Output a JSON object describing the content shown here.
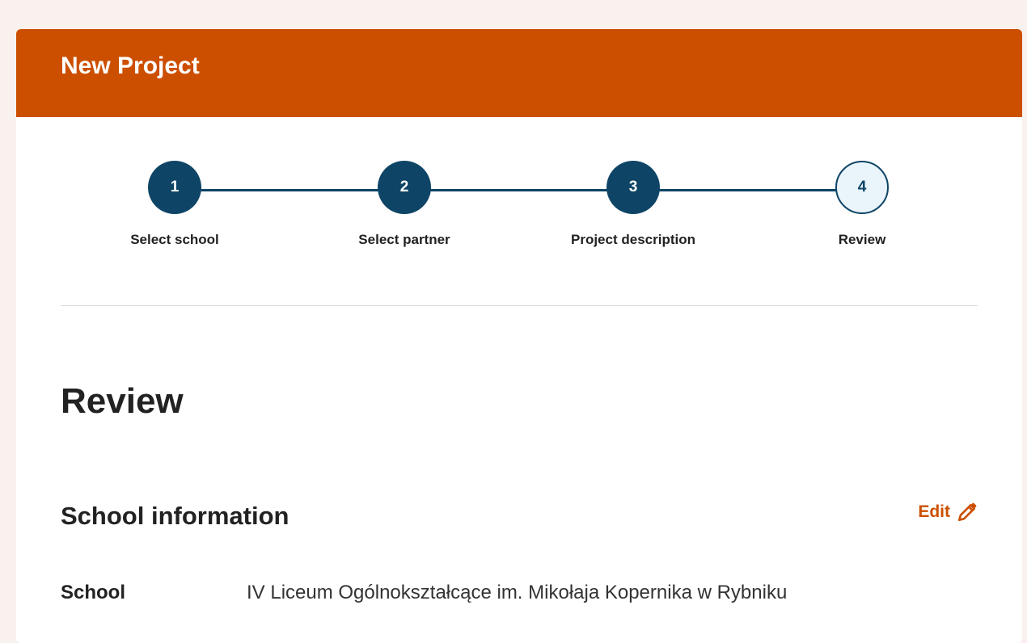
{
  "header": {
    "title": "New Project"
  },
  "stepper": {
    "steps": [
      {
        "number": "1",
        "label": "Select school"
      },
      {
        "number": "2",
        "label": "Select partner"
      },
      {
        "number": "3",
        "label": "Project description"
      },
      {
        "number": "4",
        "label": "Review"
      }
    ],
    "current_step": 4
  },
  "main": {
    "heading": "Review",
    "school_section": {
      "title": "School information",
      "edit_label": "Edit",
      "edit_icon": "pencil-icon",
      "rows": [
        {
          "label": "School",
          "value": "IV Liceum Ogólnokształcące im. Mikołaja Kopernika w Rybniku"
        }
      ]
    }
  },
  "colors": {
    "page_bg": "#f9f1ed",
    "header_bg": "#cc4f00",
    "step_fill": "#0e4566",
    "step_current_bg": "#eaf4fb",
    "link": "#cc4f00"
  }
}
